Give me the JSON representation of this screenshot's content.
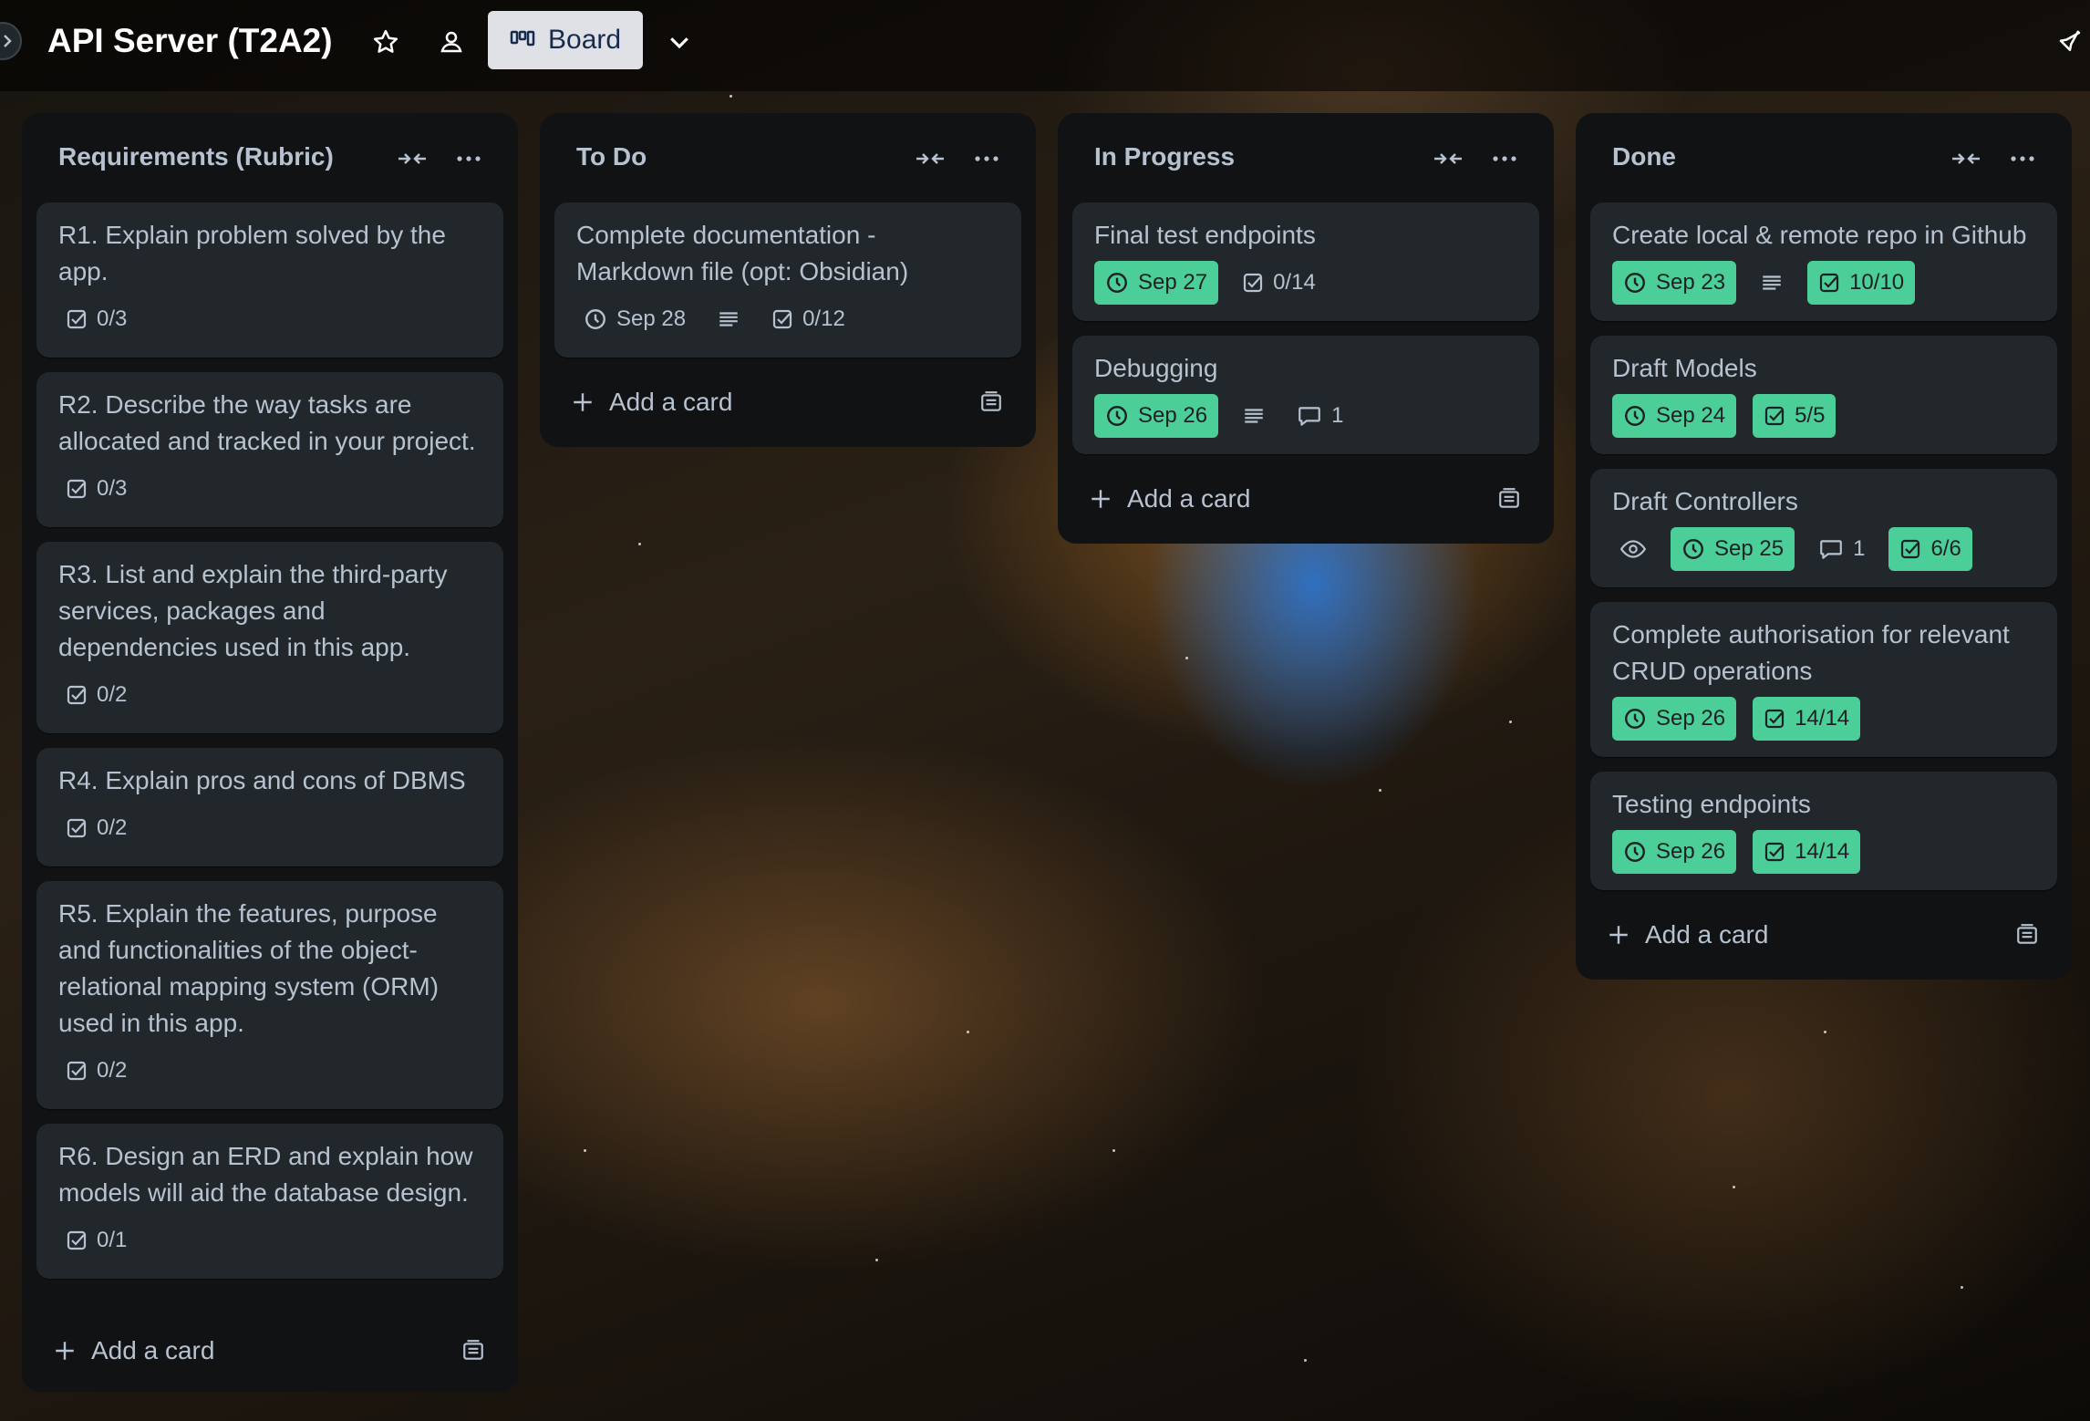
{
  "board": {
    "title": "API Server (T2A2)",
    "view_label": "Board"
  },
  "colors": {
    "list_bg": "#101214",
    "card_bg": "#22272b",
    "date_badge": "#4bce97",
    "text": "#b6c2cf",
    "view_button": "#dfe1e6"
  },
  "lists": [
    {
      "title": "Requirements (Rubric)",
      "add_label": "Add a card",
      "cards": [
        {
          "title": "R1. Explain problem solved by the app.",
          "checklist": "0/3"
        },
        {
          "title": "R2. Describe the way tasks are allocated and tracked in your project.",
          "checklist": "0/3"
        },
        {
          "title": "R3. List and explain the third-party services, packages and dependencies used in this app.",
          "checklist": "0/2"
        },
        {
          "title": "R4. Explain pros and cons of DBMS",
          "checklist": "0/2"
        },
        {
          "title": "R5. Explain the features, purpose and functionalities of the object-relational mapping system (ORM) used in this app.",
          "checklist": "0/2"
        },
        {
          "title": "R6. Design an ERD and explain how models will aid the database design.",
          "checklist": "0/1"
        }
      ]
    },
    {
      "title": "To Do",
      "add_label": "Add a card",
      "cards": [
        {
          "title": "Complete documentation - Markdown file (opt: Obsidian)",
          "date": "Sep 28",
          "checklist": "0/12"
        }
      ]
    },
    {
      "title": "In Progress",
      "add_label": "Add a card",
      "cards": [
        {
          "title": "Final test endpoints",
          "date": "Sep 27",
          "checklist": "0/14"
        },
        {
          "title": "Debugging",
          "date": "Sep 26",
          "comments": "1"
        }
      ]
    },
    {
      "title": "Done",
      "add_label": "Add a card",
      "cards": [
        {
          "title": "Create local & remote repo in Github",
          "date": "Sep 23",
          "checklist": "10/10"
        },
        {
          "title": "Draft Models",
          "date": "Sep 24",
          "checklist": "5/5"
        },
        {
          "title": "Draft Controllers",
          "date": "Sep 25",
          "comments": "1",
          "checklist": "6/6"
        },
        {
          "title": "Complete authorisation for relevant CRUD operations",
          "date": "Sep 26",
          "checklist": "14/14"
        },
        {
          "title": "Testing endpoints",
          "date": "Sep 26",
          "checklist": "14/14"
        }
      ]
    }
  ]
}
